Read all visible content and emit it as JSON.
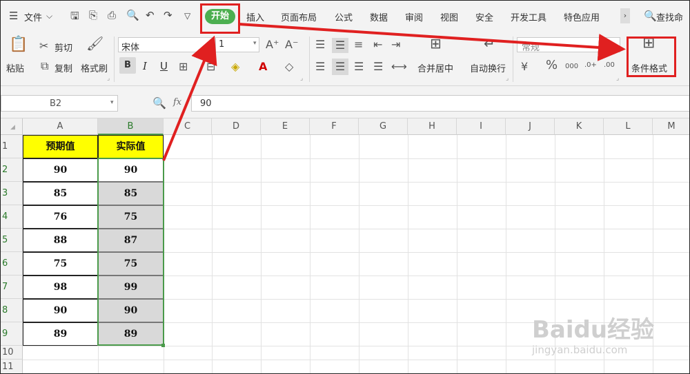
{
  "menu": {
    "file_label": "文件",
    "tabs": [
      "开始",
      "插入",
      "页面布局",
      "公式",
      "数据",
      "审阅",
      "视图",
      "安全",
      "开发工具",
      "特色应用"
    ],
    "active_tab": "开始",
    "search_label": "查找命"
  },
  "ribbon": {
    "paste_label": "粘贴",
    "cut_label": "剪切",
    "copy_label": "复制",
    "format_painter_label": "格式刷",
    "font_name": "宋体",
    "font_size": "1",
    "bold_label": "B",
    "italic_label": "I",
    "underline_label": "U",
    "merge_label": "合并居中",
    "wrap_label": "自动换行",
    "number_format": "常规",
    "conditional_format_label": "条件格式"
  },
  "formula_bar": {
    "cell_ref": "B2",
    "fx_label": "fx",
    "value": "90"
  },
  "sheet": {
    "columns": [
      "A",
      "B",
      "C",
      "D",
      "E",
      "F",
      "G",
      "H",
      "I",
      "J",
      "K",
      "L",
      "M"
    ],
    "rows": [
      "1",
      "2",
      "3",
      "4",
      "5",
      "6",
      "7",
      "8",
      "9",
      "10",
      "11"
    ],
    "header_a": "预期值",
    "header_b": "实际值",
    "data": [
      [
        "90",
        "90"
      ],
      [
        "85",
        "85"
      ],
      [
        "76",
        "75"
      ],
      [
        "88",
        "87"
      ],
      [
        "75",
        "75"
      ],
      [
        "98",
        "99"
      ],
      [
        "90",
        "90"
      ],
      [
        "89",
        "89"
      ]
    ]
  },
  "watermark": {
    "text": "Baidu经验",
    "url": "jingyan.baidu.com"
  },
  "colors": {
    "accent_green": "#4caf50",
    "highlight_red": "#e02020",
    "header_yellow": "#ffff00"
  }
}
